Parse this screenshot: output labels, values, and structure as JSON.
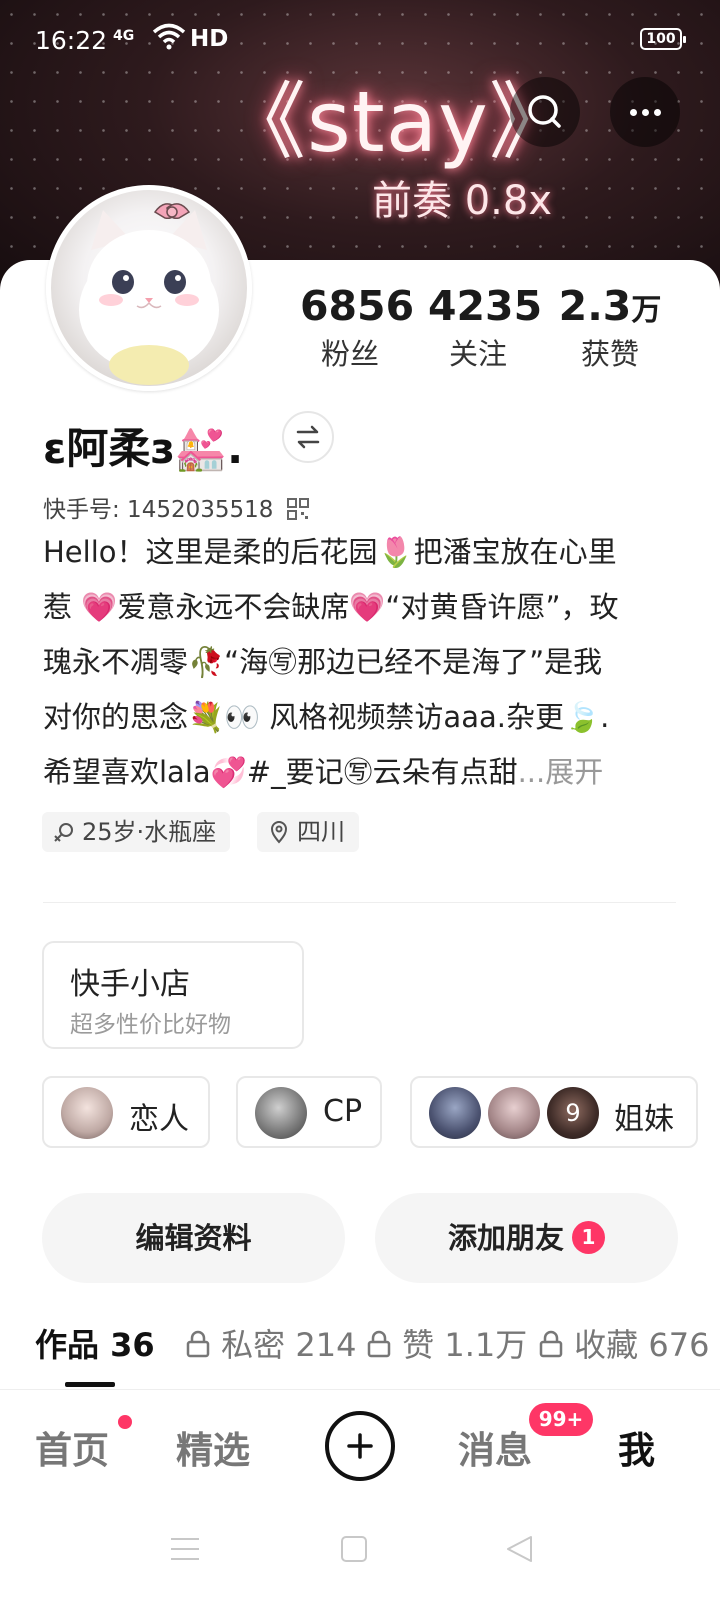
{
  "status_bar": {
    "time": "16:22",
    "network": "4G",
    "hd": "HD",
    "battery": "100"
  },
  "banner": {
    "title": "《stay》",
    "subtitle": "前奏 0.8x"
  },
  "profile": {
    "stats": [
      {
        "value": "6856",
        "unit": "",
        "label": "粉丝"
      },
      {
        "value": "4235",
        "unit": "",
        "label": "关注"
      },
      {
        "value": "2.3",
        "unit": "万",
        "label": "获赞"
      }
    ],
    "username": "ε阿柔з💒.",
    "kuaishou_id": "快手号: 1452035518",
    "bio_lines": [
      "Hello！这里是柔的后花园🌷把潘宝放在心里",
      "惹 💗爱意永远不会缺席💗“对黄昏许愿”，玫",
      "瑰永不凋零🥀“海㊢那边已经不是海了”是我",
      "对你的思念💐👀 风格视频禁访aaa.杂更🍃.",
      "希望喜欢lala💞#_要记㊢云朵有点甜"
    ],
    "expand_label": "...展开",
    "tags": [
      "25岁·水瓶座",
      "四川"
    ]
  },
  "shop": {
    "title": "快手小店",
    "subtitle": "超多性价比好物"
  },
  "relations": [
    {
      "label": "恋人"
    },
    {
      "label": "CP"
    },
    {
      "label": "姐妹",
      "avatar_text": "9"
    }
  ],
  "actions": {
    "edit_label": "编辑资料",
    "add_friend_label": "添加朋友",
    "add_friend_badge": "1"
  },
  "tabs": [
    {
      "label": "作品 36"
    },
    {
      "label": "私密 214"
    },
    {
      "label": "赞 1.1万"
    },
    {
      "label": "收藏 676"
    }
  ],
  "bottom_nav": {
    "home": "首页",
    "featured": "精选",
    "messages": "消息",
    "messages_badge": "99+",
    "me": "我"
  },
  "colors": {
    "accent": "#fe3666",
    "banner_dark": "#2e1a1d"
  }
}
